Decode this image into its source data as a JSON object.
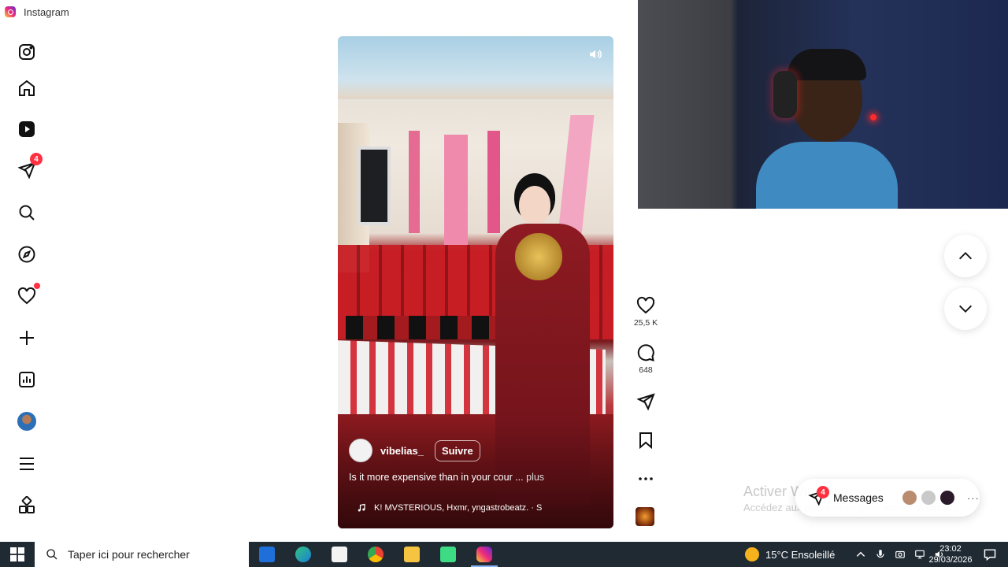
{
  "window": {
    "title": "Instagram"
  },
  "sidebar": {
    "items": [
      {
        "name": "logo",
        "icon": "instagram-logo-icon"
      },
      {
        "name": "home",
        "icon": "home-icon"
      },
      {
        "name": "reels",
        "icon": "reels-icon"
      },
      {
        "name": "messages",
        "icon": "send-icon",
        "badge": "4"
      },
      {
        "name": "search",
        "icon": "search-icon"
      },
      {
        "name": "explore",
        "icon": "compass-icon"
      },
      {
        "name": "notifications",
        "icon": "heart-icon"
      },
      {
        "name": "create",
        "icon": "plus-icon"
      },
      {
        "name": "dashboard",
        "icon": "chart-icon"
      },
      {
        "name": "profile",
        "icon": "avatar"
      },
      {
        "name": "more",
        "icon": "menu-icon"
      },
      {
        "name": "also-from-meta",
        "icon": "apps-icon"
      }
    ]
  },
  "reel": {
    "username": "vibelias_",
    "follow_label": "Suivre",
    "caption": "Is it more expensive than in your cour ...",
    "caption_more": "plus",
    "audio": "K!  MVSTERIOUS, Hxmr, yngastrobeatz. · S",
    "likes": "25,5 K",
    "comments": "648"
  },
  "messages": {
    "label": "Messages",
    "badge": "4",
    "more": "···"
  },
  "watermark": {
    "line1": "Activer Windows",
    "line2": "Accédez aux paramètres pour activer Windows."
  },
  "taskbar": {
    "search_placeholder": "Taper ici pour rechercher",
    "weather": "15°C  Ensoleillé",
    "time": "23:02",
    "date": "29/03/2026"
  },
  "colors": {
    "accent": "#ff3040",
    "taskbar": "#1f2a33"
  }
}
